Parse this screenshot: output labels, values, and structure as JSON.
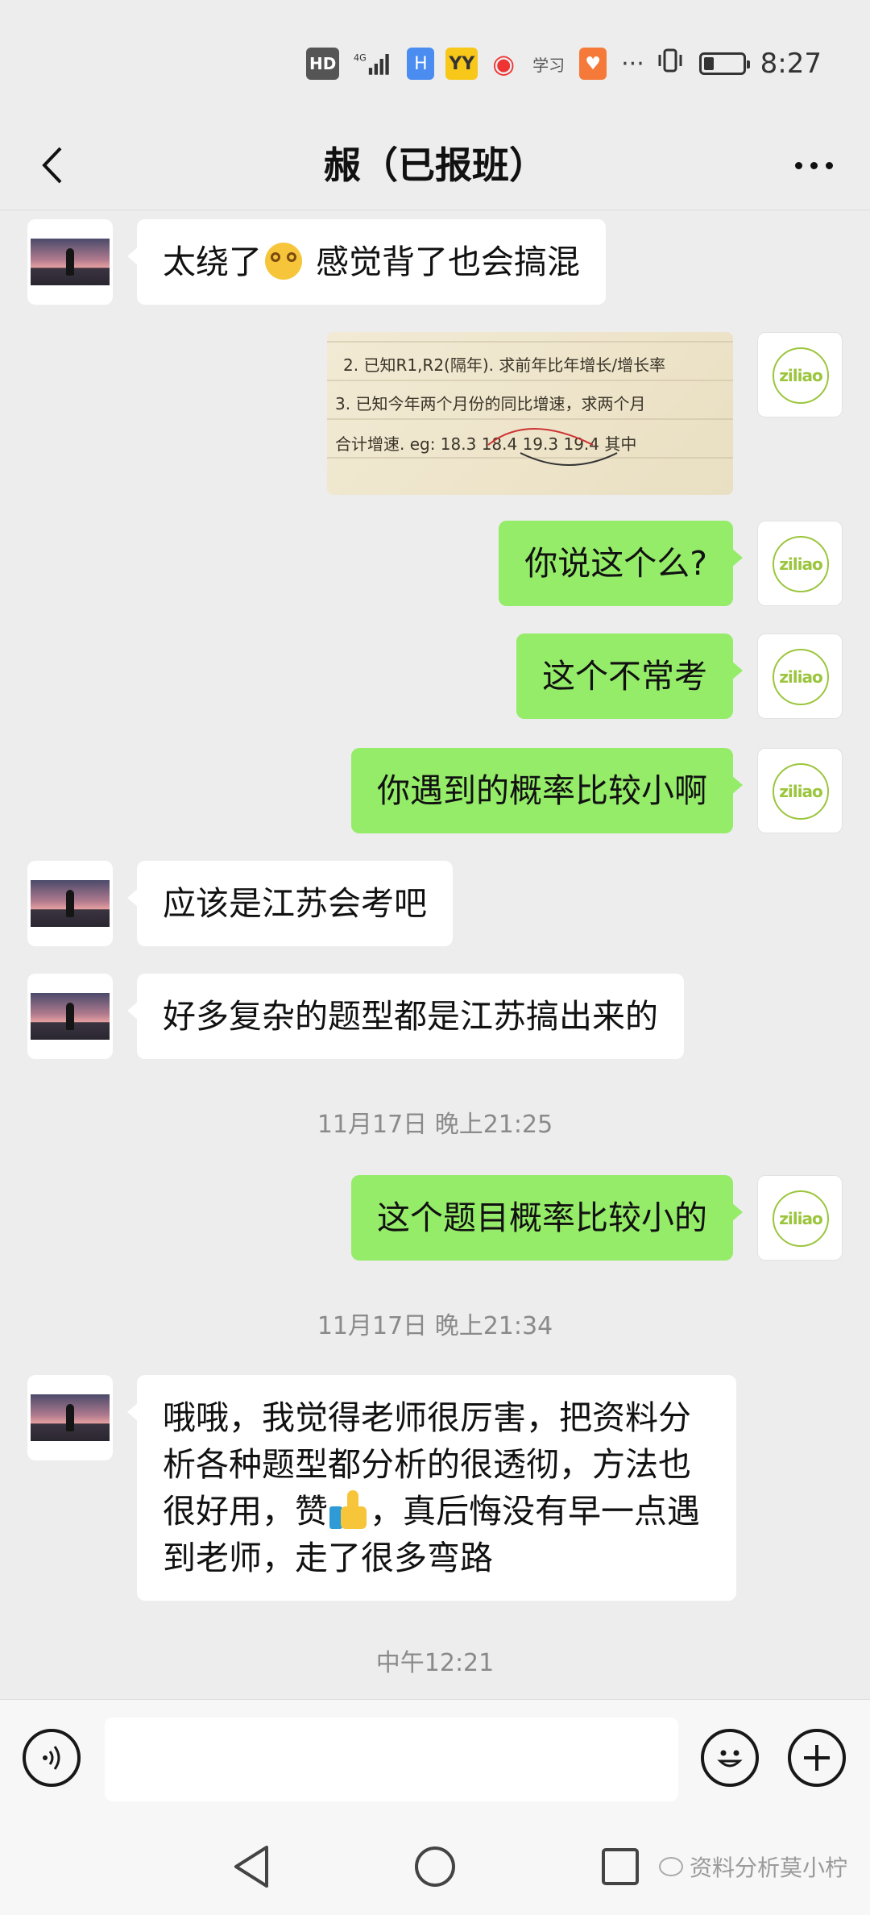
{
  "status_bar": {
    "hd": "HD",
    "network": "4G",
    "time": "8:27",
    "battery_level": 0.25,
    "icons": [
      "hd-icon",
      "signal-icon",
      "app-h-icon",
      "yy-icon",
      "weibo-icon",
      "xuexi-icon",
      "heart-app-icon",
      "more-dots-icon",
      "vibrate-icon",
      "battery-icon"
    ],
    "app_labels": {
      "h": "H",
      "yy": "YY",
      "weibo": "◉",
      "xuexi": "学习",
      "heart": "♥",
      "more": "···"
    }
  },
  "header": {
    "title": "赧（已报班）"
  },
  "messages": [
    {
      "side": "in",
      "text_before": "太绕了",
      "emoji": "dizzy-face",
      "text_after": " 感觉背了也会搞混"
    },
    {
      "side": "out",
      "type": "image",
      "image_text": [
        "2. 已知R1,R2(隔年). 求前年比年增长/增长率",
        "3. 已知今年两个月份的同比增速，求两个月",
        "合计增速. eg: 18.3  18.4   19.3  19.4  其中"
      ]
    },
    {
      "side": "out",
      "text": "你说这个么?"
    },
    {
      "side": "out",
      "text": "这个不常考"
    },
    {
      "side": "out",
      "text": "你遇到的概率比较小啊"
    },
    {
      "side": "in",
      "text": "应该是江苏会考吧"
    },
    {
      "side": "in",
      "text": "好多复杂的题型都是江苏搞出来的"
    },
    {
      "side": "time",
      "text": "11月17日 晚上21:25"
    },
    {
      "side": "out",
      "text": "这个题目概率比较小的"
    },
    {
      "side": "time",
      "text": "11月17日 晚上21:34"
    },
    {
      "side": "in",
      "text_before": "哦哦，我觉得老师很厉害，把资料分析各种题型都分析的很透彻，方法也很好用，赞",
      "emoji": "thumbs-up",
      "text_after": "，真后悔没有早一点遇到老师，走了很多弯路"
    },
    {
      "side": "time",
      "text": "中午12:21"
    }
  ],
  "avatar_logo_text": "ziliao",
  "input": {
    "placeholder": "",
    "value": ""
  },
  "watermark": "资料分析莫小柠",
  "colors": {
    "background": "#ededed",
    "outgoing_bubble": "#95ec69",
    "incoming_bubble": "#ffffff",
    "timestamp": "#8a8a8a"
  }
}
